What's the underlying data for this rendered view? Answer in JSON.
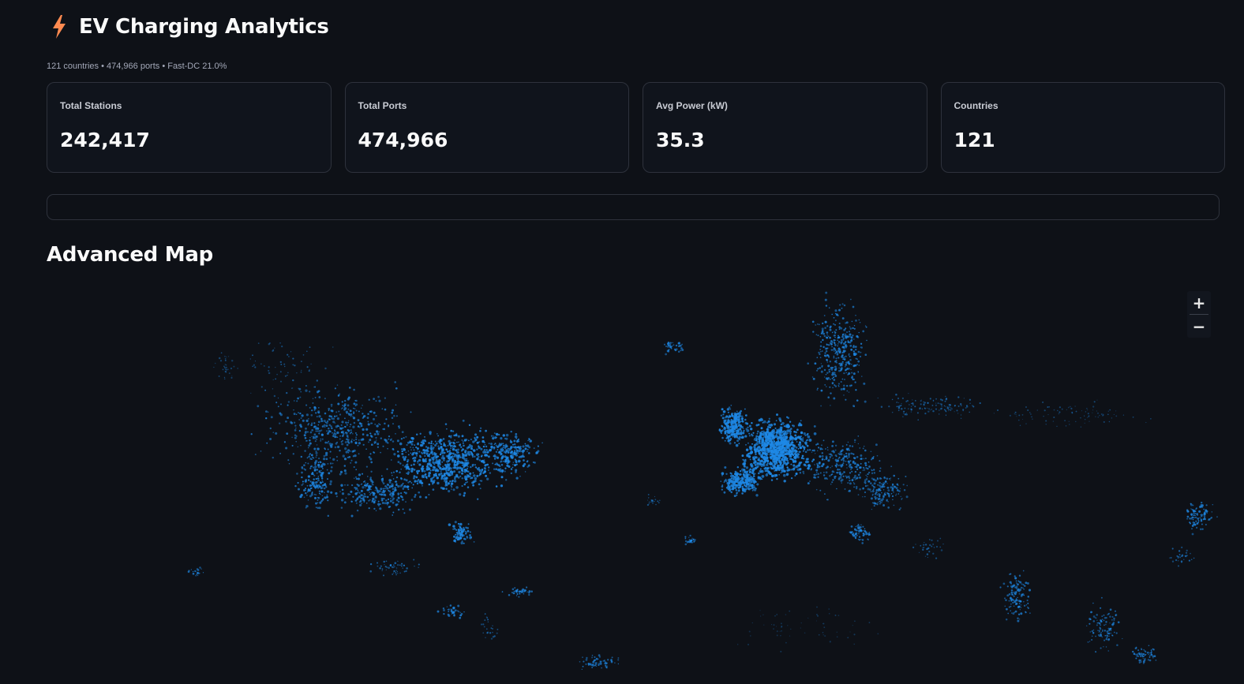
{
  "header": {
    "icon": "lightning-bolt-icon",
    "title": "EV Charging Analytics",
    "caption": "121 countries • 474,966 ports • Fast-DC 21.0%"
  },
  "metrics": [
    {
      "label": "Total Stations",
      "value": "242,417"
    },
    {
      "label": "Total Ports",
      "value": "474,966"
    },
    {
      "label": "Avg Power (kW)",
      "value": "35.3"
    },
    {
      "label": "Countries",
      "value": "121"
    }
  ],
  "map": {
    "section_title": "Advanced Map",
    "point_color": "#1e88e5",
    "zoom_in_label": "+",
    "zoom_out_label": "−"
  },
  "colors": {
    "background": "#0e1117",
    "bolt": "#ff8a50",
    "card_border": "#2e323c"
  }
}
